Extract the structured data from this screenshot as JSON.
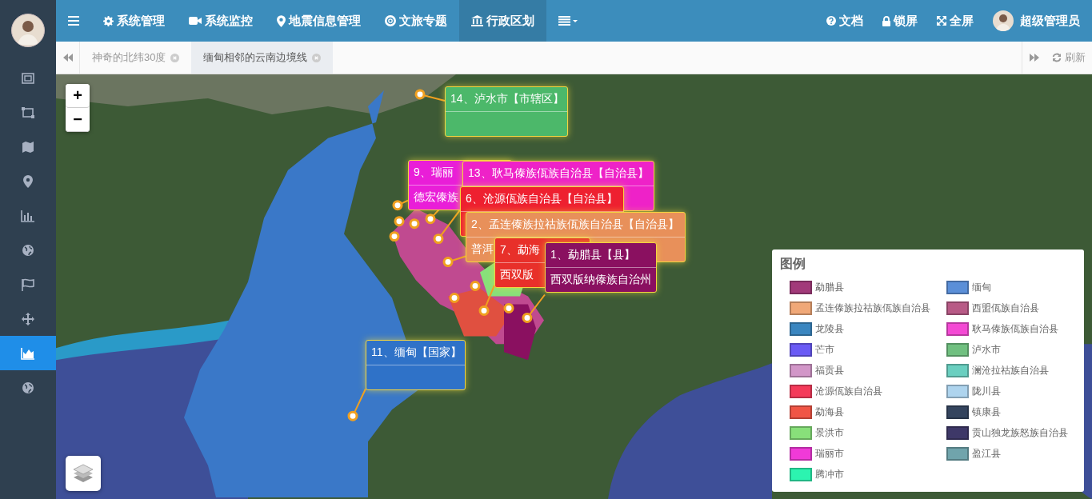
{
  "sidebar": {
    "items": [
      {
        "selected": false
      },
      {
        "selected": false
      },
      {
        "selected": false
      },
      {
        "selected": false
      },
      {
        "selected": false
      },
      {
        "selected": false
      },
      {
        "selected": false
      },
      {
        "selected": false
      },
      {
        "selected": true
      },
      {
        "selected": false
      }
    ]
  },
  "navbar": {
    "items": [
      {
        "label": "系统管理",
        "selected": false
      },
      {
        "label": "系统监控",
        "selected": false
      },
      {
        "label": "地震信息管理",
        "selected": false
      },
      {
        "label": "文旅专题",
        "selected": false
      },
      {
        "label": "行政区划",
        "selected": true
      }
    ],
    "links": [
      {
        "label": "文档"
      },
      {
        "label": "锁屏"
      },
      {
        "label": "全屏"
      }
    ],
    "user": {
      "name": "超级管理员"
    }
  },
  "tabs": [
    {
      "label": "神奇的北纬30度",
      "selected": false
    },
    {
      "label": "缅甸相邻的云南边境线",
      "selected": true
    }
  ],
  "refresh_button": {
    "label": "刷新"
  },
  "map": {
    "zoom_in": "+",
    "zoom_out": "−",
    "popups": [
      {
        "title": "14、泸水市【市辖区】",
        "color": "#4cb86a"
      },
      {
        "title": "9、瑞丽",
        "subtitle": "德宏傣族",
        "color": "#e91ed8"
      },
      {
        "title": "13、耿马傣族佤族自治县【自治县】",
        "color": "#ee22c8"
      },
      {
        "title": "6、沧源佤族自治县【自治县】",
        "color": "#ee2030"
      },
      {
        "title": "2、孟连傣族拉祜族佤族自治县【自治县】",
        "subtitle": "普洱",
        "color": "#e8905a"
      },
      {
        "title": "7、勐海",
        "subtitle": "西双版",
        "color": "#e8302a"
      },
      {
        "title": "1、勐腊县【县】",
        "subtitle": "西双版纳傣族自治州",
        "color": "#8a1060"
      },
      {
        "title": "11、缅甸【国家】",
        "color": "#2f72c8"
      }
    ],
    "legend": {
      "title": "图例",
      "items": [
        {
          "label": "勐腊县",
          "color": "#a23a7a"
        },
        {
          "label": "缅甸",
          "color": "#5b8fd8"
        },
        {
          "label": "孟连傣族拉祜族佤族自治县",
          "color": "#f0a878"
        },
        {
          "label": "西盟佤族自治县",
          "color": "#b85a86"
        },
        {
          "label": "龙陵县",
          "color": "#3a86c0"
        },
        {
          "label": "耿马傣族佤族自治县",
          "color": "#f44ad4"
        },
        {
          "label": "芒市",
          "color": "#6a5af5"
        },
        {
          "label": "泸水市",
          "color": "#70c080"
        },
        {
          "label": "福贡县",
          "color": "#d296c8"
        },
        {
          "label": "澜沧拉祜族自治县",
          "color": "#6acfc0"
        },
        {
          "label": "沧源佤族自治县",
          "color": "#f43a5a"
        },
        {
          "label": "陇川县",
          "color": "#aed4ee"
        },
        {
          "label": "勐海县",
          "color": "#f05545"
        },
        {
          "label": "镇康县",
          "color": "#34445e"
        },
        {
          "label": "景洪市",
          "color": "#88e07a"
        },
        {
          "label": "贡山独龙族怒族自治县",
          "color": "#3e3868"
        },
        {
          "label": "瑞丽市",
          "color": "#f03ad8"
        },
        {
          "label": "盈江县",
          "color": "#70a4ac"
        },
        {
          "label": "腾冲市",
          "color": "#2cf4b0"
        }
      ]
    }
  }
}
